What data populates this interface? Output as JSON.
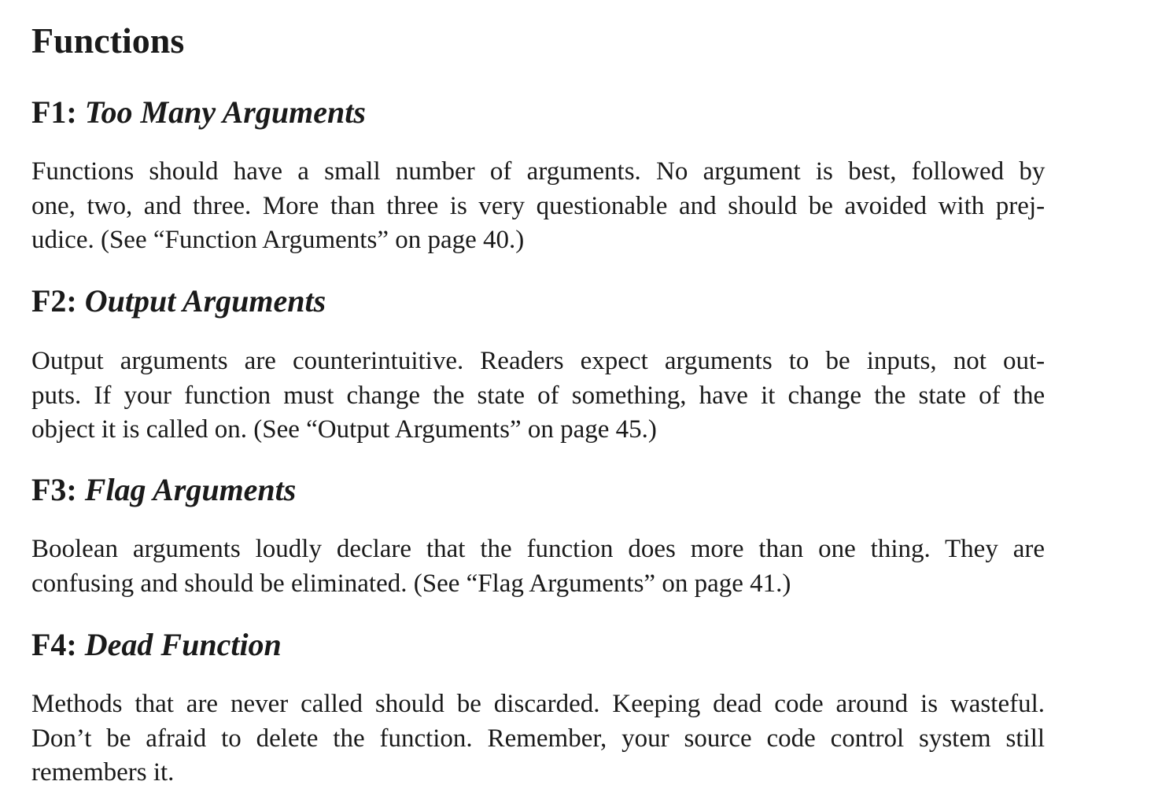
{
  "section_title": "Functions",
  "rules": [
    {
      "code": "F1:",
      "name": "Too Many Arguments",
      "lines": [
        "Functions should have a small number of arguments. No argument is best, followed by",
        "one, two, and three. More than three is very questionable and should be avoided with prej-",
        "udice. (See “Function Arguments” on page 40.)"
      ]
    },
    {
      "code": "F2:",
      "name": "Output Arguments",
      "lines": [
        "Output arguments are counterintuitive. Readers expect arguments to be inputs, not out-",
        "puts. If your function must change the state of something, have it change the state of the",
        "object it is called on. (See “Output Arguments” on page 45.)"
      ]
    },
    {
      "code": "F3:",
      "name": "Flag Arguments",
      "lines": [
        "Boolean arguments loudly declare that the function does more than one thing. They are",
        "confusing and should be eliminated. (See “Flag Arguments” on page 41.)"
      ]
    },
    {
      "code": "F4:",
      "name": "Dead Function",
      "lines": [
        "Methods that are never called should be discarded. Keeping dead code around is wasteful.",
        "Don’t be afraid to delete the function. Remember, your source code control system still",
        "remembers it."
      ]
    }
  ]
}
